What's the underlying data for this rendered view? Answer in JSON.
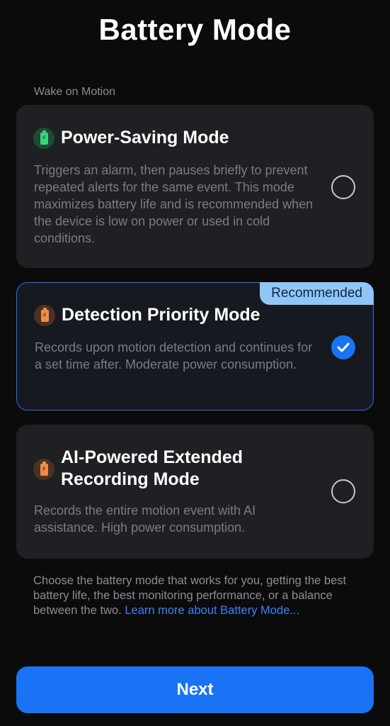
{
  "header": {
    "title": "Battery Mode"
  },
  "section": {
    "label": "Wake on Motion"
  },
  "modes": [
    {
      "title": "Power-Saving Mode",
      "description": "Triggers an alarm, then pauses briefly to prevent repeated alerts for the same event. This mode maximizes battery life and is recommended when the device is low on power or used in cold conditions.",
      "icon": "battery-icon",
      "icon_color": "#3bd67d",
      "selected": false
    },
    {
      "title": "Detection Priority Mode",
      "description": "Records upon motion detection and continues for a set time after. Moderate power consumption.",
      "icon": "battery-icon",
      "icon_color": "#f08a4a",
      "badge": "Recommended",
      "selected": true
    },
    {
      "title": "AI-Powered Extended Recording Mode",
      "description": "Records the entire motion event with AI assistance. High power consumption.",
      "icon": "battery-icon",
      "icon_color": "#f08a4a",
      "selected": false
    }
  ],
  "footer": {
    "text": "Choose the battery mode that works for you, getting the best battery life, the best monitoring performance, or a balance between the two. ",
    "link": "Learn more about Battery Mode..."
  },
  "actions": {
    "next_label": "Next"
  },
  "colors": {
    "accent": "#1a73f5",
    "badge_bg": "#8fc6f7",
    "link": "#3b82f6"
  }
}
